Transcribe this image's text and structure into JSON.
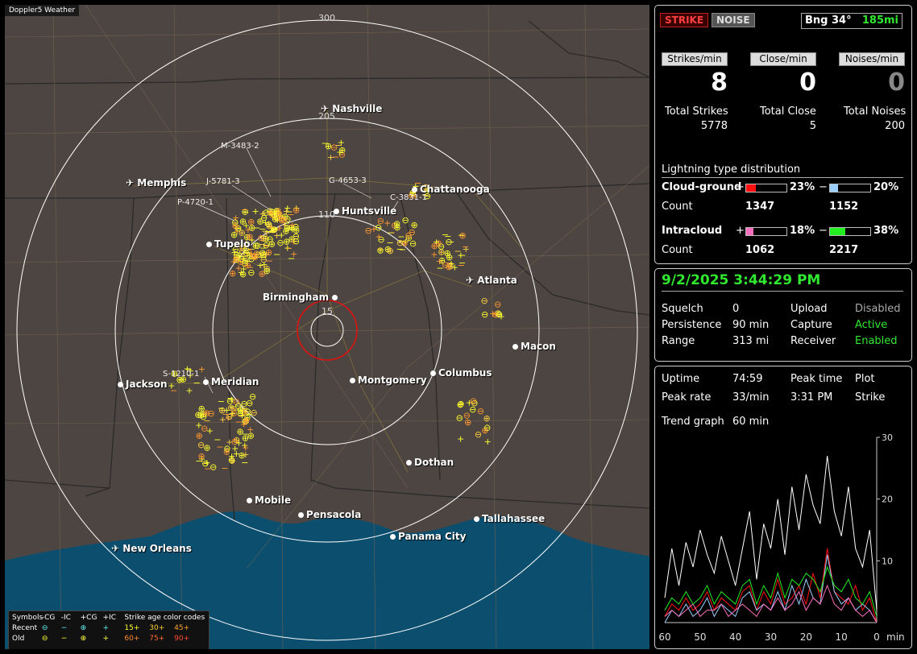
{
  "map": {
    "title": "Doppler5 Weather",
    "ring_labels": [
      "300",
      "205",
      "110",
      "15"
    ],
    "cities": [
      {
        "name": "Nashville",
        "icon": "airport"
      },
      {
        "name": "Memphis",
        "icon": "airport"
      },
      {
        "name": "Chattanooga",
        "icon": "dot"
      },
      {
        "name": "Huntsville",
        "icon": "dot"
      },
      {
        "name": "Tupelo",
        "icon": "dot"
      },
      {
        "name": "Atlanta",
        "icon": "airport"
      },
      {
        "name": "Birmingham",
        "icon": "dot"
      },
      {
        "name": "Macon",
        "icon": "dot"
      },
      {
        "name": "Jackson",
        "icon": "dot"
      },
      {
        "name": "Meridian",
        "icon": "dot"
      },
      {
        "name": "Montgomery",
        "icon": "dot"
      },
      {
        "name": "Columbus",
        "icon": "dot"
      },
      {
        "name": "Dothan",
        "icon": "dot"
      },
      {
        "name": "Mobile",
        "icon": "dot"
      },
      {
        "name": "Pensacola",
        "icon": "dot"
      },
      {
        "name": "Tallahassee",
        "icon": "dot"
      },
      {
        "name": "Panama City",
        "icon": "dot"
      },
      {
        "name": "New Orleans",
        "icon": "airport"
      }
    ],
    "strike_labels": [
      "M-3483-2",
      "J-5781-3",
      "P-4720-1",
      "G-4653-3",
      "C-3831-1",
      "S-1210-1"
    ],
    "legend": {
      "symbols_title": "Symbols",
      "col_neg_cg": "-CG",
      "col_neg_ic": "-IC",
      "col_pos_cg": "+CG",
      "col_pos_ic": "+IC",
      "age_title": "Strike age color codes",
      "recent_label": "Recent",
      "old_label": "Old",
      "recent_ages": [
        "15+",
        "30+",
        "45+"
      ],
      "old_ages": [
        "60+",
        "75+",
        "90+"
      ]
    }
  },
  "status": {
    "strike_button": "STRIKE",
    "noise_button": "NOISE",
    "bearing": "Bng 34°",
    "distance": "185mi",
    "strikes_min_label": "Strikes/min",
    "close_min_label": "Close/min",
    "noises_min_label": "Noises/min",
    "strikes_min": "8",
    "close_min": "0",
    "noises_min": "0",
    "total_strikes_label": "Total Strikes",
    "total_close_label": "Total Close",
    "total_noises_label": "Total Noises",
    "total_strikes": "5778",
    "total_close": "5",
    "total_noises": "200",
    "dist_title": "Lightning type distribution",
    "cg_label": "Cloud-ground",
    "ic_label": "Intracloud",
    "count_label": "Count",
    "cg_pos_pct": "23%",
    "cg_neg_pct": "20%",
    "cg_pos_count": "1347",
    "cg_neg_count": "1152",
    "ic_pos_pct": "18%",
    "ic_neg_pct": "38%",
    "ic_pos_count": "1062",
    "ic_neg_count": "2217",
    "plus": "+",
    "minus": "−"
  },
  "info": {
    "datetime": "9/2/2025 3:44:29 PM",
    "squelch_label": "Squelch",
    "squelch": "0",
    "persistence_label": "Persistence",
    "persistence": "90 min",
    "range_label": "Range",
    "range": "313 mi",
    "upload_label": "Upload",
    "upload": "Disabled",
    "capture_label": "Capture",
    "capture": "Active",
    "receiver_label": "Receiver",
    "receiver": "Enabled"
  },
  "trend": {
    "uptime_label": "Uptime",
    "uptime": "74:59",
    "peak_time_label": "Peak time",
    "peak_time": "3:31 PM",
    "plot_label": "Plot",
    "plot": "Strike",
    "peak_rate_label": "Peak rate",
    "peak_rate": "33/min",
    "trend_graph_label": "Trend graph",
    "trend_graph": "60 min",
    "y_ticks": [
      "30",
      "20",
      "10"
    ],
    "x_ticks": [
      "60",
      "50",
      "40",
      "30",
      "20",
      "10",
      "0"
    ],
    "x_unit": "min"
  },
  "colors": {
    "cg_pos": "#ff1010",
    "cg_neg": "#9ad0ff",
    "ic_pos": "#ff6fbf",
    "ic_neg": "#22ee22",
    "strike_bright": "#ffff30",
    "strike_orange": "#ff9a30",
    "accent_green": "#2fe82f"
  },
  "chart_data": {
    "type": "line",
    "title": "",
    "xlabel": "min",
    "ylabel": "",
    "xlim": [
      60,
      0
    ],
    "ylim": [
      0,
      30
    ],
    "x": [
      60,
      58,
      56,
      54,
      52,
      50,
      48,
      46,
      44,
      42,
      40,
      38,
      36,
      34,
      32,
      30,
      28,
      26,
      24,
      22,
      20,
      18,
      16,
      14,
      12,
      10,
      8,
      6,
      4,
      2,
      0
    ],
    "series": [
      {
        "name": "Strike",
        "values": [
          4,
          12,
          6,
          13,
          9,
          15,
          11,
          8,
          14,
          10,
          6,
          12,
          18,
          7,
          16,
          12,
          20,
          11,
          22,
          15,
          24,
          19,
          16,
          27,
          18,
          14,
          22,
          12,
          9,
          15,
          2
        ]
      },
      {
        "name": "+CG",
        "values": [
          1,
          3,
          2,
          4,
          2,
          3,
          5,
          2,
          4,
          3,
          2,
          5,
          6,
          2,
          5,
          3,
          7,
          3,
          4,
          6,
          3,
          8,
          4,
          12,
          5,
          4,
          3,
          6,
          2,
          4,
          0
        ]
      },
      {
        "name": "-CG",
        "values": [
          0,
          2,
          1,
          3,
          1,
          2,
          4,
          1,
          3,
          2,
          1,
          4,
          5,
          2,
          3,
          2,
          5,
          2,
          6,
          3,
          7,
          4,
          3,
          11,
          5,
          3,
          4,
          2,
          3,
          2,
          0
        ]
      },
      {
        "name": "+IC",
        "values": [
          1,
          2,
          1,
          2,
          3,
          1,
          2,
          2,
          3,
          1,
          2,
          3,
          2,
          1,
          3,
          2,
          4,
          2,
          3,
          5,
          2,
          4,
          3,
          6,
          3,
          2,
          4,
          2,
          1,
          2,
          0
        ]
      },
      {
        "name": "-IC",
        "values": [
          2,
          4,
          3,
          5,
          3,
          4,
          6,
          3,
          5,
          4,
          3,
          6,
          7,
          3,
          6,
          4,
          8,
          4,
          7,
          6,
          8,
          7,
          5,
          9,
          6,
          5,
          7,
          4,
          3,
          5,
          1
        ]
      }
    ]
  }
}
